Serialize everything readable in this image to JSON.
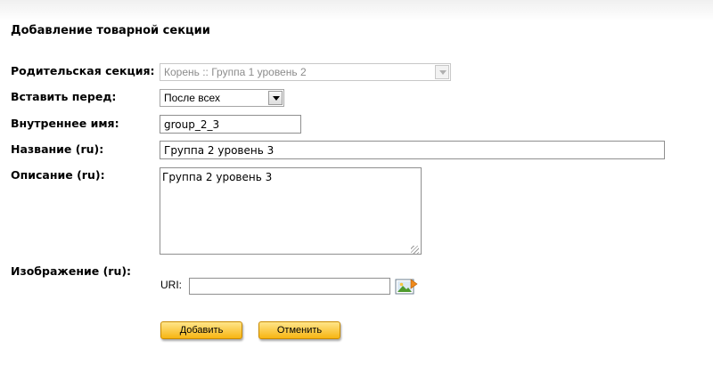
{
  "form": {
    "title": "Добавление товарной секции",
    "parent_section": {
      "label": "Родительская секция:",
      "value": "Корень :: Группа 1 уровень 2"
    },
    "insert_before": {
      "label": "Вставить перед:",
      "value": "После всех"
    },
    "internal_name": {
      "label": "Внутреннее имя:",
      "value": "group_2_3"
    },
    "name_ru": {
      "label": "Название (ru):",
      "value": "Группа 2 уровень 3"
    },
    "description_ru": {
      "label": "Описание (ru):",
      "value": "Группа 2 уровень 3"
    },
    "image_ru": {
      "label": "Изображение (ru):",
      "uri_label": "URI:",
      "uri_value": ""
    },
    "add_button": "Добавить",
    "cancel_button": "Отменить"
  },
  "colors": {
    "button_gradient_top": "#ffe58a",
    "button_gradient_bottom": "#f7b512",
    "button_border": "#c98a00"
  },
  "icons": {
    "image_picker": "image-picker-icon"
  }
}
